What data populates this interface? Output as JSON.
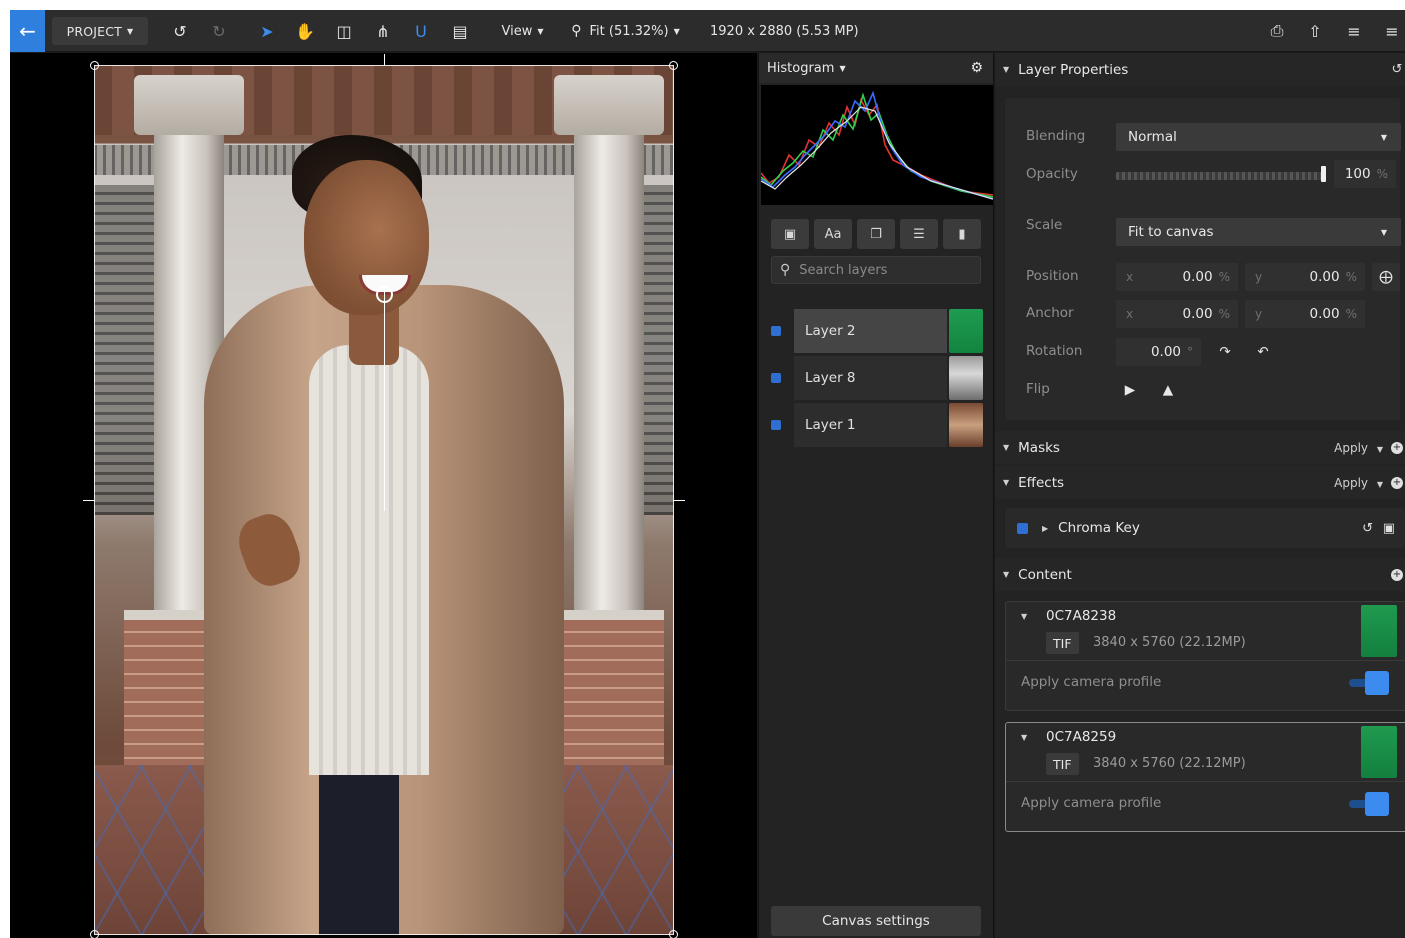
{
  "toolbar": {
    "project_label": "PROJECT",
    "view_label": "View",
    "zoom_label": "Fit (51.32%)",
    "canvas_size": "1920 x 2880 (5.53 MP)"
  },
  "layers_panel": {
    "histogram_label": "Histogram",
    "tool_text_label": "Aa",
    "search_placeholder": "Search layers",
    "layers": [
      {
        "name": "Layer 2",
        "active": true
      },
      {
        "name": "Layer 8",
        "active": false
      },
      {
        "name": "Layer 1",
        "active": false
      }
    ],
    "canvas_settings_label": "Canvas settings"
  },
  "properties": {
    "title": "Layer Properties",
    "blending_label": "Blending",
    "blending_value": "Normal",
    "opacity_label": "Opacity",
    "opacity_value": "100",
    "opacity_unit": "%",
    "opacity_level": 1.0,
    "scale_label": "Scale",
    "scale_value": "Fit to canvas",
    "position_label": "Position",
    "position_x": "0.00",
    "position_y": "0.00",
    "anchor_label": "Anchor",
    "anchor_x": "0.00",
    "anchor_y": "0.00",
    "rotation_label": "Rotation",
    "rotation_value": "0.00",
    "rotation_unit": "°",
    "flip_label": "Flip",
    "axis_x": "x",
    "axis_y": "y",
    "pct": "%"
  },
  "masks": {
    "title": "Masks",
    "apply_label": "Apply"
  },
  "effects": {
    "title": "Effects",
    "apply_label": "Apply",
    "items": [
      {
        "name": "Chroma Key"
      }
    ]
  },
  "content": {
    "title": "Content",
    "items": [
      {
        "name": "0C7A8238",
        "format": "TIF",
        "dims": "3840 x 5760 (22.12MP)",
        "toggle_label": "Apply camera profile",
        "toggle_on": true
      },
      {
        "name": "0C7A8259",
        "format": "TIF",
        "dims": "3840 x 5760 (22.12MP)",
        "toggle_label": "Apply camera profile",
        "toggle_on": true
      }
    ]
  },
  "colors": {
    "accent": "#3c8cf0",
    "panel_bg": "#232323",
    "toolbar_bg": "#2c2c2c"
  }
}
